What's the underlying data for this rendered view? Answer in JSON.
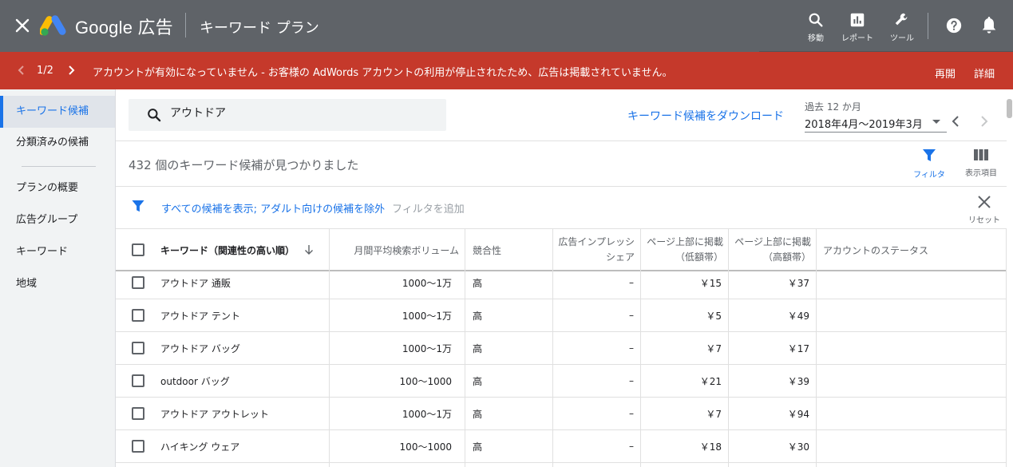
{
  "topbar": {
    "brand": "Google 広告",
    "page_title": "キーワード プラン",
    "nav": [
      {
        "label": "移動",
        "icon": "search-icon"
      },
      {
        "label": "レポート",
        "icon": "bar-chart-icon"
      },
      {
        "label": "ツール",
        "icon": "wrench-icon"
      }
    ]
  },
  "alert": {
    "counter": "1/2",
    "message": "アカウントが有効になっていません - お客様の AdWords アカウントの利用が停止されたため、広告は掲載されていません。",
    "resume": "再開",
    "details": "詳細",
    "color": "#c5392b"
  },
  "sidebar": {
    "items": [
      {
        "label": "キーワード候補",
        "active": true
      },
      {
        "label": "分類済みの候補"
      },
      {
        "label": "プランの概要"
      },
      {
        "label": "広告グループ"
      },
      {
        "label": "キーワード"
      },
      {
        "label": "地域"
      }
    ]
  },
  "search": {
    "value": "アウトドア"
  },
  "download_link": "キーワード候補をダウンロード",
  "period": {
    "label": "過去 12 か月",
    "value": "2018年4月～2019年3月"
  },
  "results": {
    "count_text": "432 個のキーワード候補が見つかりました"
  },
  "tools": {
    "filter": "フィルタ",
    "columns": "表示項目",
    "reset": "リセット"
  },
  "filter_bar": {
    "active_filter": "すべての候補を表示; アダルト向けの候補を除外",
    "add": "フィルタを追加"
  },
  "table": {
    "headers": {
      "keyword": "キーワード（関連性の高い順）",
      "volume": "月間平均検索ボリューム",
      "competition": "競合性",
      "impression_share_1": "広告インプレッシ",
      "impression_share_2": "シェア",
      "bid_low_1": "ページ上部に掲載",
      "bid_low_2": "（低額帯）",
      "bid_high_1": "ページ上部に掲載",
      "bid_high_2": "（高額帯）",
      "status": "アカウントのステータス"
    },
    "rows": [
      {
        "keyword": "アウトドア 通販",
        "volume": "1000～1万",
        "competition": "高",
        "share": "–",
        "low": "￥15",
        "high": "￥37"
      },
      {
        "keyword": "アウトドア テント",
        "volume": "1000～1万",
        "competition": "高",
        "share": "–",
        "low": "￥5",
        "high": "￥49"
      },
      {
        "keyword": "アウトドア バッグ",
        "volume": "1000～1万",
        "competition": "高",
        "share": "–",
        "low": "￥7",
        "high": "￥17"
      },
      {
        "keyword": "outdoor バッグ",
        "volume": "100～1000",
        "competition": "高",
        "share": "–",
        "low": "￥21",
        "high": "￥39"
      },
      {
        "keyword": "アウトドア アウトレット",
        "volume": "1000～1万",
        "competition": "高",
        "share": "–",
        "low": "￥7",
        "high": "￥94"
      },
      {
        "keyword": "ハイキング ウェア",
        "volume": "100～1000",
        "competition": "高",
        "share": "–",
        "low": "￥18",
        "high": "￥30"
      }
    ]
  }
}
